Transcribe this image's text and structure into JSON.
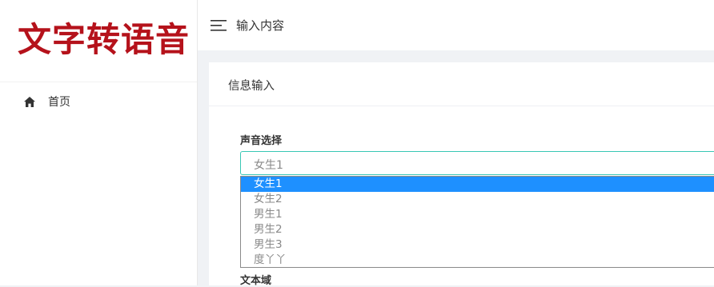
{
  "sidebar": {
    "logo_text": "文字转语音",
    "nav": [
      {
        "label": "首页",
        "icon": "home-icon"
      }
    ]
  },
  "header": {
    "title": "输入内容",
    "menu_icon": "menu-icon"
  },
  "card": {
    "title": "信息输入",
    "voice_field": {
      "label": "声音选择",
      "selected": "女生1",
      "options": [
        "女生1",
        "女生2",
        "男生1",
        "男生2",
        "男生3",
        "度丫丫"
      ]
    },
    "text_field": {
      "label": "文本域"
    }
  },
  "colors": {
    "logo": "#b5121b",
    "selection": "#1e90ff",
    "focus_border": "#39c7b5"
  }
}
